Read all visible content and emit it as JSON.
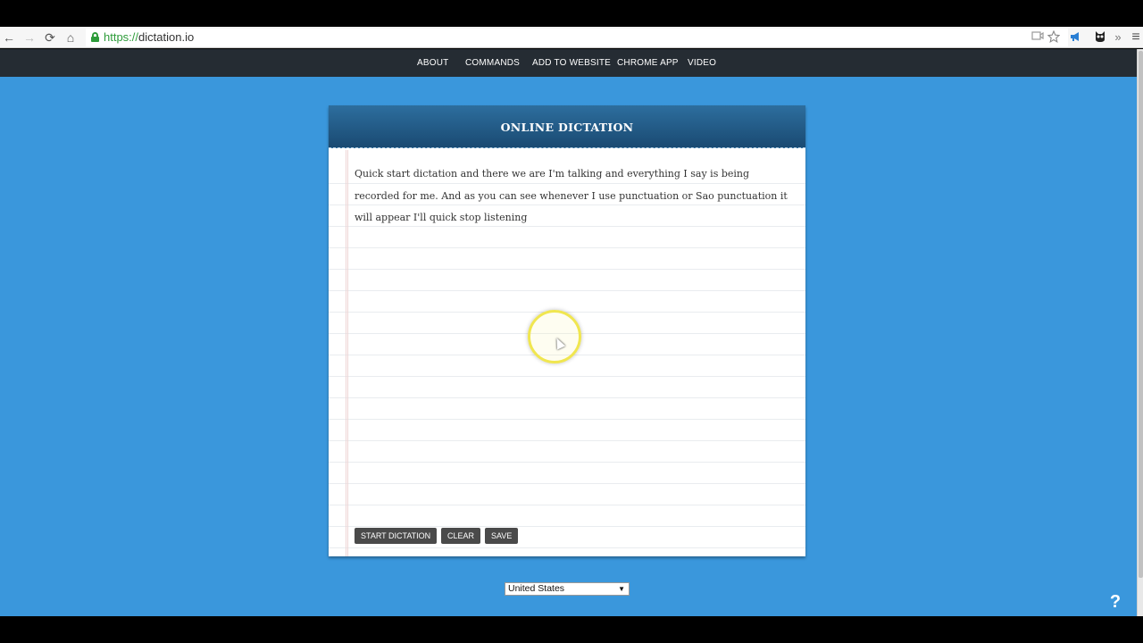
{
  "browser": {
    "url_scheme": "https://",
    "url_host": "dictation.io",
    "back_icon": "←",
    "forward_icon": "→",
    "reload_icon": "⟳",
    "home_icon": "⌂",
    "overflow_icon": "»",
    "menu_icon": "≡"
  },
  "nav": {
    "items": [
      "ABOUT",
      "COMMANDS",
      "ADD TO WEBSITE",
      "CHROME APP",
      "VIDEO"
    ]
  },
  "card": {
    "title": "ONLINE DICTATION",
    "text": "Quick start dictation and there we are I'm talking and everything I say is being recorded for me. And as you can see whenever I use punctuation or Sao punctuation it will appear I'll quick stop listening",
    "buttons": {
      "start": "START DICTATION",
      "clear": "CLEAR",
      "save": "SAVE"
    }
  },
  "language_select": {
    "value": "United States",
    "arrow": "▼"
  },
  "help": "?",
  "colors": {
    "page_bg": "#3a97dc",
    "nav_bg": "#252c33",
    "header_bg": "#1a4a72",
    "button_bg": "#4a4a4a"
  }
}
